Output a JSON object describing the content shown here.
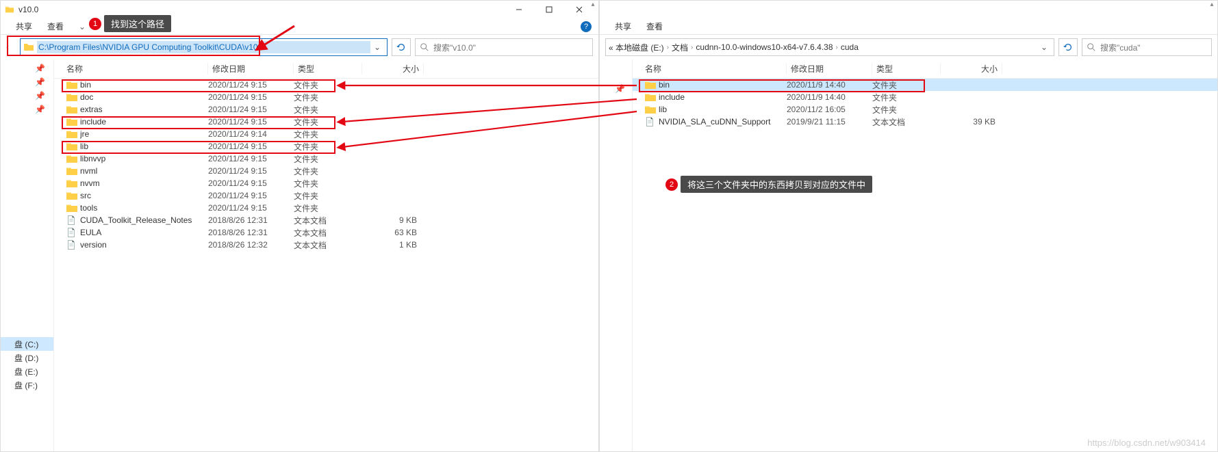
{
  "left": {
    "title": "v10.0",
    "tabs": {
      "share": "共享",
      "view": "查看"
    },
    "address": "C:\\Program Files\\NVIDIA GPU Computing Toolkit\\CUDA\\v10.0",
    "search_placeholder": "搜索\"v10.0\"",
    "columns": {
      "name": "名称",
      "date": "修改日期",
      "type": "类型",
      "size": "大小"
    },
    "rows": [
      {
        "icon": "folder",
        "name": "bin",
        "date": "2020/11/24 9:15",
        "type": "文件夹",
        "size": ""
      },
      {
        "icon": "folder",
        "name": "doc",
        "date": "2020/11/24 9:15",
        "type": "文件夹",
        "size": ""
      },
      {
        "icon": "folder",
        "name": "extras",
        "date": "2020/11/24 9:15",
        "type": "文件夹",
        "size": ""
      },
      {
        "icon": "folder",
        "name": "include",
        "date": "2020/11/24 9:15",
        "type": "文件夹",
        "size": ""
      },
      {
        "icon": "folder",
        "name": "jre",
        "date": "2020/11/24 9:14",
        "type": "文件夹",
        "size": ""
      },
      {
        "icon": "folder",
        "name": "lib",
        "date": "2020/11/24 9:15",
        "type": "文件夹",
        "size": ""
      },
      {
        "icon": "folder",
        "name": "libnvvp",
        "date": "2020/11/24 9:15",
        "type": "文件夹",
        "size": ""
      },
      {
        "icon": "folder",
        "name": "nvml",
        "date": "2020/11/24 9:15",
        "type": "文件夹",
        "size": ""
      },
      {
        "icon": "folder",
        "name": "nvvm",
        "date": "2020/11/24 9:15",
        "type": "文件夹",
        "size": ""
      },
      {
        "icon": "folder",
        "name": "src",
        "date": "2020/11/24 9:15",
        "type": "文件夹",
        "size": ""
      },
      {
        "icon": "folder",
        "name": "tools",
        "date": "2020/11/24 9:15",
        "type": "文件夹",
        "size": ""
      },
      {
        "icon": "doc",
        "name": "CUDA_Toolkit_Release_Notes",
        "date": "2018/8/26 12:31",
        "type": "文本文档",
        "size": "9 KB"
      },
      {
        "icon": "doc",
        "name": "EULA",
        "date": "2018/8/26 12:31",
        "type": "文本文档",
        "size": "63 KB"
      },
      {
        "icon": "doc",
        "name": "version",
        "date": "2018/8/26 12:32",
        "type": "文本文档",
        "size": "1 KB"
      }
    ],
    "drives": [
      {
        "label": "盘 (C:)",
        "sel": true
      },
      {
        "label": "盘 (D:)",
        "sel": false
      },
      {
        "label": "盘 (E:)",
        "sel": false
      },
      {
        "label": "盘 (F:)",
        "sel": false
      }
    ]
  },
  "right": {
    "tabs": {
      "share": "共享",
      "view": "查看"
    },
    "crumbs": [
      "« 本地磁盘 (E:)",
      "文档",
      "cudnn-10.0-windows10-x64-v7.6.4.38",
      "cuda"
    ],
    "search_placeholder": "搜索\"cuda\"",
    "columns": {
      "name": "名称",
      "date": "修改日期",
      "type": "类型",
      "size": "大小"
    },
    "rows": [
      {
        "icon": "folder",
        "name": "bin",
        "date": "2020/11/9 14:40",
        "type": "文件夹",
        "size": "",
        "sel": true
      },
      {
        "icon": "folder",
        "name": "include",
        "date": "2020/11/9 14:40",
        "type": "文件夹",
        "size": ""
      },
      {
        "icon": "folder",
        "name": "lib",
        "date": "2020/11/2 16:05",
        "type": "文件夹",
        "size": ""
      },
      {
        "icon": "doc",
        "name": "NVIDIA_SLA_cuDNN_Support",
        "date": "2019/9/21 11:15",
        "type": "文本文档",
        "size": "39 KB"
      }
    ]
  },
  "annotations": {
    "callout1": "找到这个路径",
    "callout2": "将这三个文件夹中的东西拷贝到对应的文件中"
  },
  "watermark": "https://blog.csdn.net/w903414"
}
